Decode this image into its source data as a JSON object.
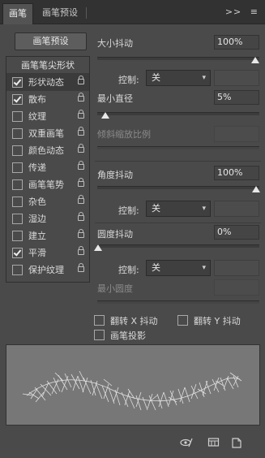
{
  "tabs": {
    "active": "画笔",
    "inactive": "画笔预设",
    "more": ">>",
    "menu_icon": "hamburger-menu-icon"
  },
  "left": {
    "preset_button": "画笔预设",
    "header": "画笔笔尖形状",
    "items": [
      {
        "label": "形状动态",
        "checked": true,
        "active": true
      },
      {
        "label": "散布",
        "checked": true,
        "active": false
      },
      {
        "label": "纹理",
        "checked": false,
        "active": false
      },
      {
        "label": "双重画笔",
        "checked": false,
        "active": false
      },
      {
        "label": "颜色动态",
        "checked": false,
        "active": false
      },
      {
        "label": "传递",
        "checked": false,
        "active": false
      },
      {
        "label": "画笔笔势",
        "checked": false,
        "active": false
      },
      {
        "label": "杂色",
        "checked": false,
        "active": false
      },
      {
        "label": "湿边",
        "checked": false,
        "active": false
      },
      {
        "label": "建立",
        "checked": false,
        "active": false
      },
      {
        "label": "平滑",
        "checked": true,
        "active": false
      },
      {
        "label": "保护纹理",
        "checked": false,
        "active": false
      }
    ]
  },
  "right": {
    "size_jitter": {
      "label": "大小抖动",
      "value": "100%",
      "level": 1.0
    },
    "size_control": {
      "label": "控制:",
      "value": "关"
    },
    "min_diameter": {
      "label": "最小直径",
      "value": "5%",
      "level": 0.05
    },
    "tilt_scale": {
      "label": "倾斜缩放比例"
    },
    "angle_jitter": {
      "label": "角度抖动",
      "value": "100%",
      "level": 1.0
    },
    "angle_control": {
      "label": "控制:",
      "value": "关"
    },
    "roundness_jitter": {
      "label": "圆度抖动",
      "value": "0%",
      "level": 0.0
    },
    "roundness_control": {
      "label": "控制:",
      "value": "关"
    },
    "min_roundness": {
      "label": "最小圆度"
    },
    "flip_x": {
      "label": "翻转 X 抖动",
      "checked": false
    },
    "flip_y": {
      "label": "翻转 Y 抖动",
      "checked": false
    },
    "brush_projection": {
      "label": "画笔投影",
      "checked": false
    }
  },
  "bottom_icons": [
    "eye-brush-icon",
    "panel-grid-icon",
    "new-page-icon"
  ]
}
